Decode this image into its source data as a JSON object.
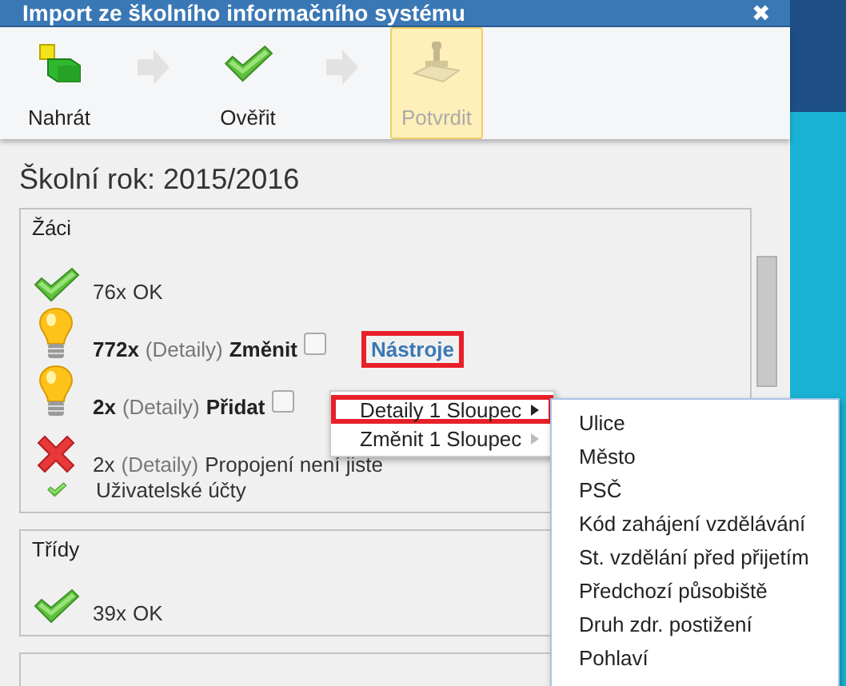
{
  "window": {
    "title": "Import ze školního informačního systému",
    "close": "✖"
  },
  "steps": [
    {
      "label": "Nahrát",
      "kind": "upload",
      "selected": false,
      "disabled": false
    },
    {
      "label": "Ověřit",
      "kind": "check",
      "selected": false,
      "disabled": false
    },
    {
      "label": "Potvrdit",
      "kind": "stamp",
      "selected": true,
      "disabled": true
    }
  ],
  "school_year": "Školní rok: 2015/2016",
  "sections": [
    {
      "title": "Žáci",
      "rows": [
        {
          "kind": "ok",
          "count": "76x",
          "text": "OK"
        },
        {
          "kind": "warning",
          "count": "772x",
          "details": "(Detaily)",
          "action": "Změnit",
          "checked": false,
          "tools": "Nástroje",
          "tools_highlighted": true
        },
        {
          "kind": "warning",
          "count": "2x",
          "details": "(Detaily)",
          "action": "Přidat",
          "checked": false
        },
        {
          "kind": "error",
          "count": "2x",
          "details": "(Detaily)",
          "text": "Propojení není jiste"
        },
        {
          "kind": "small-ok",
          "text": "Uživatelské účty"
        }
      ]
    },
    {
      "title": "Třídy",
      "rows": [
        {
          "kind": "ok",
          "count": "39x",
          "text": "OK"
        }
      ]
    }
  ],
  "menu": {
    "items": [
      {
        "label": "Detaily 1 Sloupec",
        "selected": true,
        "highlighted": true
      },
      {
        "label": "Změnit 1 Sloupec",
        "selected": false,
        "highlighted": false
      }
    ],
    "submenu": [
      "Ulice",
      "Město",
      "PSČ",
      "Kód zahájení vzdělávání",
      "St. vzdělání před přijetím",
      "Předchozí působiště",
      "Druh zdr. postižení",
      "Pohlaví"
    ]
  }
}
